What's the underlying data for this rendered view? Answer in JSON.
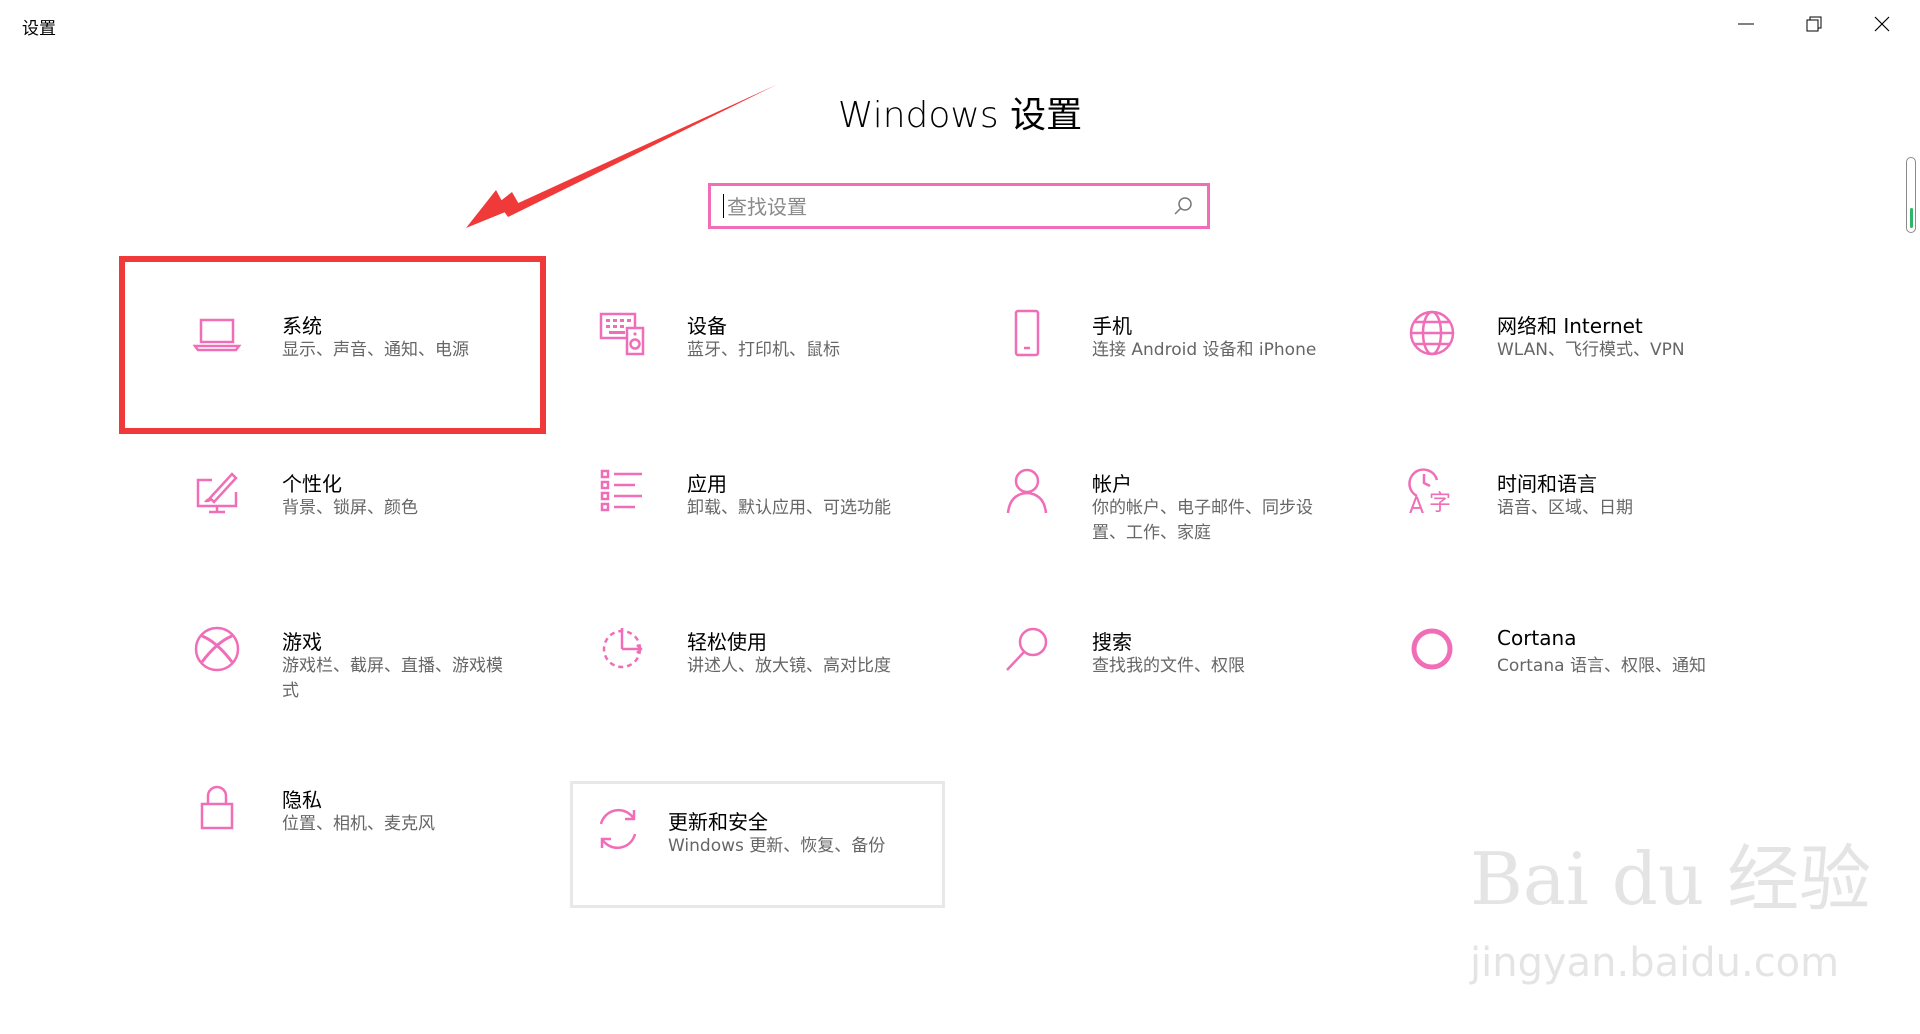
{
  "window": {
    "title": "设置",
    "controls": {
      "minimize": "minimize-icon",
      "restore": "restore-icon",
      "close": "close-icon"
    }
  },
  "page": {
    "heading": "Windows 设置"
  },
  "search": {
    "placeholder": "查找设置",
    "value": ""
  },
  "accent_color": "#f06eb8",
  "annotation_color": "#f03a3a",
  "tiles": [
    {
      "id": "system",
      "icon": "laptop-icon",
      "title": "系统",
      "desc": "显示、声音、通知、电源"
    },
    {
      "id": "devices",
      "icon": "keyboard-speaker-icon",
      "title": "设备",
      "desc": "蓝牙、打印机、鼠标"
    },
    {
      "id": "phone",
      "icon": "phone-icon",
      "title": "手机",
      "desc": "连接 Android 设备和 iPhone"
    },
    {
      "id": "network",
      "icon": "globe-icon",
      "title": "网络和 Internet",
      "desc": "WLAN、飞行模式、VPN"
    },
    {
      "id": "personalization",
      "icon": "paint-monitor-icon",
      "title": "个性化",
      "desc": "背景、锁屏、颜色"
    },
    {
      "id": "apps",
      "icon": "list-icon",
      "title": "应用",
      "desc": "卸载、默认应用、可选功能"
    },
    {
      "id": "accounts",
      "icon": "person-icon",
      "title": "帐户",
      "desc": "你的帐户、电子邮件、同步设置、工作、家庭"
    },
    {
      "id": "time-language",
      "icon": "clock-language-icon",
      "title": "时间和语言",
      "desc": "语音、区域、日期"
    },
    {
      "id": "gaming",
      "icon": "xbox-icon",
      "title": "游戏",
      "desc": "游戏栏、截屏、直播、游戏模式"
    },
    {
      "id": "ease-of-access",
      "icon": "ease-of-access-icon",
      "title": "轻松使用",
      "desc": "讲述人、放大镜、高对比度"
    },
    {
      "id": "search",
      "icon": "magnifier-icon",
      "title": "搜索",
      "desc": "查找我的文件、权限"
    },
    {
      "id": "cortana",
      "icon": "cortana-ring-icon",
      "title": "Cortana",
      "desc": "Cortana 语言、权限、通知"
    },
    {
      "id": "privacy",
      "icon": "lock-icon",
      "title": "隐私",
      "desc": "位置、相机、麦克风"
    },
    {
      "id": "update-security",
      "icon": "sync-arrows-icon",
      "title": "更新和安全",
      "desc": "Windows 更新、恢复、备份"
    }
  ],
  "watermark": {
    "main": "Bai du 经验",
    "sub": "jingyan.baidu.com"
  }
}
